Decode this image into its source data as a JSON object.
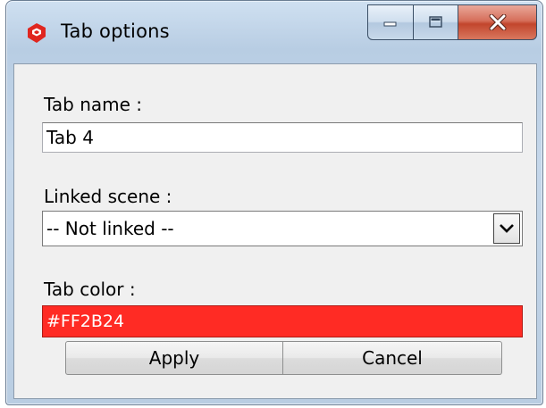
{
  "window": {
    "title": "Tab options",
    "icon": "sketchup-logo-icon",
    "controls": [
      "minimize-icon",
      "maximize-icon",
      "close-icon"
    ]
  },
  "form": {
    "tab_name_label": "Tab name :",
    "tab_name_value": "Tab 4",
    "linked_scene_label": "Linked scene :",
    "linked_scene_value": "-- Not linked --",
    "tab_color_label": "Tab color :",
    "tab_color_value": "#FF2B24"
  },
  "buttons": {
    "apply": "Apply",
    "cancel": "Cancel"
  },
  "colors": {
    "tab_color": "#FF2B24",
    "app_icon_red": "#e0261f"
  }
}
